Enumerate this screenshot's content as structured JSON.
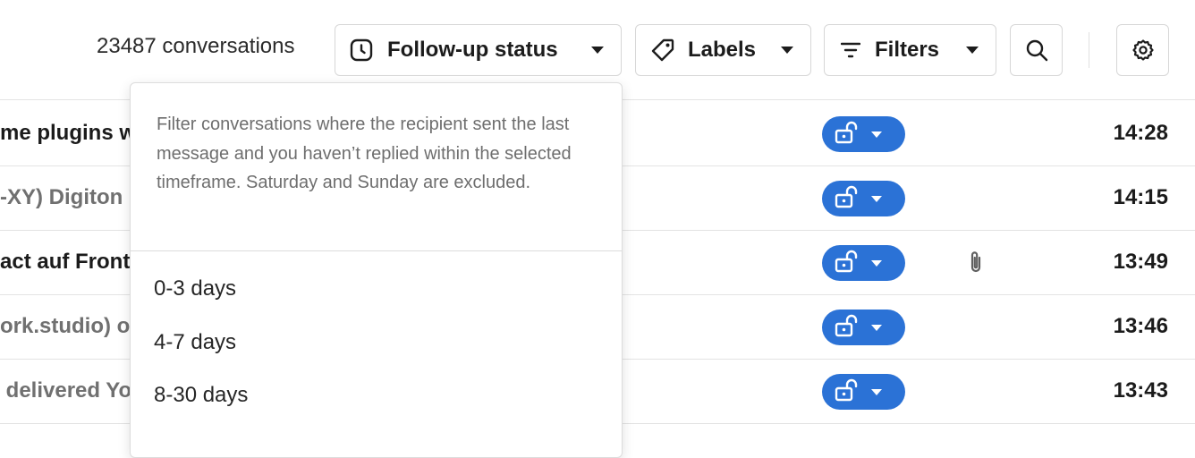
{
  "toolbar": {
    "conversation_count": "23487 conversations",
    "follow_up_label": "Follow-up status",
    "labels_label": "Labels",
    "filters_label": "Filters"
  },
  "follow_up_dropdown": {
    "description": "Filter conversations where the recipient sent the last message and you haven’t replied within the selected timeframe. Saturday and Sunday are excluded.",
    "options": [
      "0-3 days",
      "4-7 days",
      "8-30 days"
    ]
  },
  "rows": [
    {
      "subject": "me plugins w",
      "time": "14:28",
      "unread": true,
      "attachment": false
    },
    {
      "subject": "-XY) Digiton",
      "time": "14:15",
      "unread": false,
      "attachment": false
    },
    {
      "subject": "act auf Front",
      "time": "13:49",
      "unread": true,
      "attachment": true
    },
    {
      "subject": "ork.studio) o",
      "time": "13:46",
      "unread": false,
      "attachment": false
    },
    {
      "subject": " delivered Yo",
      "time": "13:43",
      "unread": false,
      "attachment": false
    }
  ],
  "colors": {
    "accent_blue": "#2b72d6",
    "border": "#d7d7d7",
    "read_text": "#707070"
  },
  "icons": [
    "clock-icon",
    "tag-icon",
    "filter-lines-icon",
    "search-icon",
    "gear-icon",
    "unlock-icon",
    "paperclip-icon",
    "caret-down-icon"
  ]
}
